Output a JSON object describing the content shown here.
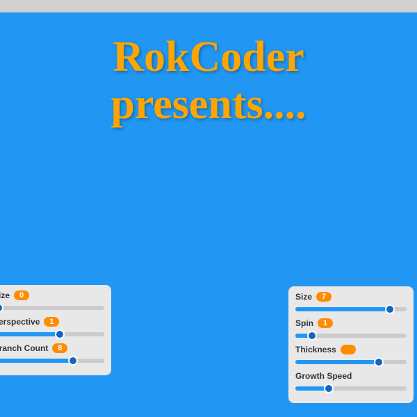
{
  "topbar": {},
  "title": {
    "line1": "RokCoder",
    "line2": "presents...."
  },
  "left_panel": {
    "controls": [
      {
        "label": "Size",
        "value": "0"
      },
      {
        "label": "Perspective",
        "value": "1"
      },
      {
        "label": "Branch Count",
        "value": "8"
      }
    ]
  },
  "right_panel": {
    "controls": [
      {
        "label": "Size",
        "value": "7"
      },
      {
        "label": "Spin",
        "value": "1"
      },
      {
        "label": "Thickness",
        "value": ""
      },
      {
        "label": "Growth Speed",
        "value": ""
      }
    ]
  }
}
